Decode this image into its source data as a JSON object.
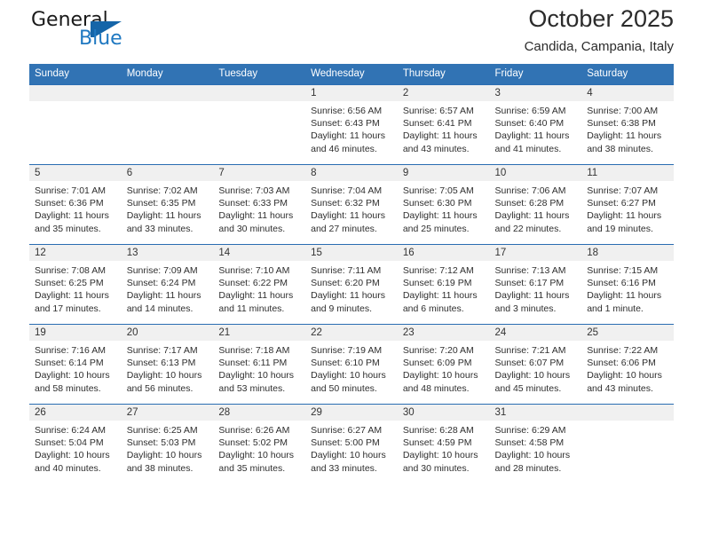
{
  "brand": {
    "name_part1": "General",
    "name_part2": "Blue",
    "accent_color": "#1f78c1",
    "triangle_color": "#1565a8"
  },
  "header": {
    "title": "October 2025",
    "subtitle": "Candida, Campania, Italy"
  },
  "theme": {
    "header_row_bg": "#3173b4",
    "row_border": "#2a6db2",
    "daynum_band_bg": "#f0f0f0"
  },
  "weekdays": [
    "Sunday",
    "Monday",
    "Tuesday",
    "Wednesday",
    "Thursday",
    "Friday",
    "Saturday"
  ],
  "weeks": [
    [
      {
        "day": "",
        "empty": true
      },
      {
        "day": "",
        "empty": true
      },
      {
        "day": "",
        "empty": true
      },
      {
        "day": "1",
        "sunrise": "Sunrise: 6:56 AM",
        "sunset": "Sunset: 6:43 PM",
        "daylight1": "Daylight: 11 hours",
        "daylight2": "and 46 minutes."
      },
      {
        "day": "2",
        "sunrise": "Sunrise: 6:57 AM",
        "sunset": "Sunset: 6:41 PM",
        "daylight1": "Daylight: 11 hours",
        "daylight2": "and 43 minutes."
      },
      {
        "day": "3",
        "sunrise": "Sunrise: 6:59 AM",
        "sunset": "Sunset: 6:40 PM",
        "daylight1": "Daylight: 11 hours",
        "daylight2": "and 41 minutes."
      },
      {
        "day": "4",
        "sunrise": "Sunrise: 7:00 AM",
        "sunset": "Sunset: 6:38 PM",
        "daylight1": "Daylight: 11 hours",
        "daylight2": "and 38 minutes."
      }
    ],
    [
      {
        "day": "5",
        "sunrise": "Sunrise: 7:01 AM",
        "sunset": "Sunset: 6:36 PM",
        "daylight1": "Daylight: 11 hours",
        "daylight2": "and 35 minutes."
      },
      {
        "day": "6",
        "sunrise": "Sunrise: 7:02 AM",
        "sunset": "Sunset: 6:35 PM",
        "daylight1": "Daylight: 11 hours",
        "daylight2": "and 33 minutes."
      },
      {
        "day": "7",
        "sunrise": "Sunrise: 7:03 AM",
        "sunset": "Sunset: 6:33 PM",
        "daylight1": "Daylight: 11 hours",
        "daylight2": "and 30 minutes."
      },
      {
        "day": "8",
        "sunrise": "Sunrise: 7:04 AM",
        "sunset": "Sunset: 6:32 PM",
        "daylight1": "Daylight: 11 hours",
        "daylight2": "and 27 minutes."
      },
      {
        "day": "9",
        "sunrise": "Sunrise: 7:05 AM",
        "sunset": "Sunset: 6:30 PM",
        "daylight1": "Daylight: 11 hours",
        "daylight2": "and 25 minutes."
      },
      {
        "day": "10",
        "sunrise": "Sunrise: 7:06 AM",
        "sunset": "Sunset: 6:28 PM",
        "daylight1": "Daylight: 11 hours",
        "daylight2": "and 22 minutes."
      },
      {
        "day": "11",
        "sunrise": "Sunrise: 7:07 AM",
        "sunset": "Sunset: 6:27 PM",
        "daylight1": "Daylight: 11 hours",
        "daylight2": "and 19 minutes."
      }
    ],
    [
      {
        "day": "12",
        "sunrise": "Sunrise: 7:08 AM",
        "sunset": "Sunset: 6:25 PM",
        "daylight1": "Daylight: 11 hours",
        "daylight2": "and 17 minutes."
      },
      {
        "day": "13",
        "sunrise": "Sunrise: 7:09 AM",
        "sunset": "Sunset: 6:24 PM",
        "daylight1": "Daylight: 11 hours",
        "daylight2": "and 14 minutes."
      },
      {
        "day": "14",
        "sunrise": "Sunrise: 7:10 AM",
        "sunset": "Sunset: 6:22 PM",
        "daylight1": "Daylight: 11 hours",
        "daylight2": "and 11 minutes."
      },
      {
        "day": "15",
        "sunrise": "Sunrise: 7:11 AM",
        "sunset": "Sunset: 6:20 PM",
        "daylight1": "Daylight: 11 hours",
        "daylight2": "and 9 minutes."
      },
      {
        "day": "16",
        "sunrise": "Sunrise: 7:12 AM",
        "sunset": "Sunset: 6:19 PM",
        "daylight1": "Daylight: 11 hours",
        "daylight2": "and 6 minutes."
      },
      {
        "day": "17",
        "sunrise": "Sunrise: 7:13 AM",
        "sunset": "Sunset: 6:17 PM",
        "daylight1": "Daylight: 11 hours",
        "daylight2": "and 3 minutes."
      },
      {
        "day": "18",
        "sunrise": "Sunrise: 7:15 AM",
        "sunset": "Sunset: 6:16 PM",
        "daylight1": "Daylight: 11 hours",
        "daylight2": "and 1 minute."
      }
    ],
    [
      {
        "day": "19",
        "sunrise": "Sunrise: 7:16 AM",
        "sunset": "Sunset: 6:14 PM",
        "daylight1": "Daylight: 10 hours",
        "daylight2": "and 58 minutes."
      },
      {
        "day": "20",
        "sunrise": "Sunrise: 7:17 AM",
        "sunset": "Sunset: 6:13 PM",
        "daylight1": "Daylight: 10 hours",
        "daylight2": "and 56 minutes."
      },
      {
        "day": "21",
        "sunrise": "Sunrise: 7:18 AM",
        "sunset": "Sunset: 6:11 PM",
        "daylight1": "Daylight: 10 hours",
        "daylight2": "and 53 minutes."
      },
      {
        "day": "22",
        "sunrise": "Sunrise: 7:19 AM",
        "sunset": "Sunset: 6:10 PM",
        "daylight1": "Daylight: 10 hours",
        "daylight2": "and 50 minutes."
      },
      {
        "day": "23",
        "sunrise": "Sunrise: 7:20 AM",
        "sunset": "Sunset: 6:09 PM",
        "daylight1": "Daylight: 10 hours",
        "daylight2": "and 48 minutes."
      },
      {
        "day": "24",
        "sunrise": "Sunrise: 7:21 AM",
        "sunset": "Sunset: 6:07 PM",
        "daylight1": "Daylight: 10 hours",
        "daylight2": "and 45 minutes."
      },
      {
        "day": "25",
        "sunrise": "Sunrise: 7:22 AM",
        "sunset": "Sunset: 6:06 PM",
        "daylight1": "Daylight: 10 hours",
        "daylight2": "and 43 minutes."
      }
    ],
    [
      {
        "day": "26",
        "sunrise": "Sunrise: 6:24 AM",
        "sunset": "Sunset: 5:04 PM",
        "daylight1": "Daylight: 10 hours",
        "daylight2": "and 40 minutes."
      },
      {
        "day": "27",
        "sunrise": "Sunrise: 6:25 AM",
        "sunset": "Sunset: 5:03 PM",
        "daylight1": "Daylight: 10 hours",
        "daylight2": "and 38 minutes."
      },
      {
        "day": "28",
        "sunrise": "Sunrise: 6:26 AM",
        "sunset": "Sunset: 5:02 PM",
        "daylight1": "Daylight: 10 hours",
        "daylight2": "and 35 minutes."
      },
      {
        "day": "29",
        "sunrise": "Sunrise: 6:27 AM",
        "sunset": "Sunset: 5:00 PM",
        "daylight1": "Daylight: 10 hours",
        "daylight2": "and 33 minutes."
      },
      {
        "day": "30",
        "sunrise": "Sunrise: 6:28 AM",
        "sunset": "Sunset: 4:59 PM",
        "daylight1": "Daylight: 10 hours",
        "daylight2": "and 30 minutes."
      },
      {
        "day": "31",
        "sunrise": "Sunrise: 6:29 AM",
        "sunset": "Sunset: 4:58 PM",
        "daylight1": "Daylight: 10 hours",
        "daylight2": "and 28 minutes."
      },
      {
        "day": "",
        "empty": true
      }
    ]
  ]
}
